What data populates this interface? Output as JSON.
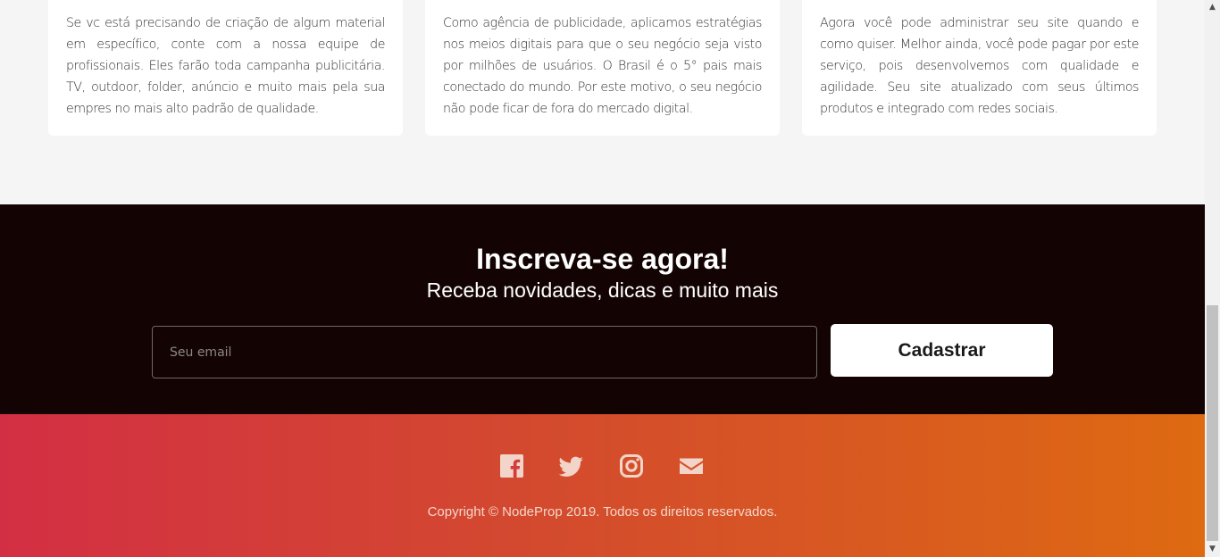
{
  "services": {
    "cards": [
      {
        "text": "Se vc está precisando de criação de algum material em específico, conte com a nossa equipe de profissionais. Eles farão toda campanha publicitária. TV, outdoor, folder, anúncio e muito mais pela sua empres no mais alto padrão de qualidade."
      },
      {
        "text": "Como agência de publicidade, aplicamos estratégias nos meios digitais para que o seu negócio seja visto por milhões de usuários. O Brasil é o 5° pais mais conectado do mundo. Por este motivo, o seu negócio não pode ficar de fora do mercado digital."
      },
      {
        "text": "Agora você pode administrar seu site quando e como quiser. Melhor ainda, você pode pagar por este serviço, pois desenvolvemos com qualidade e agilidade. Seu site atualizado com seus últimos produtos e integrado com redes sociais."
      }
    ]
  },
  "subscribe": {
    "title": "Inscreva-se agora!",
    "subtitle": "Receba novidades, dicas e muito mais",
    "email_placeholder": "Seu email",
    "button_label": "Cadastrar"
  },
  "footer": {
    "social": [
      {
        "icon": "facebook-icon"
      },
      {
        "icon": "twitter-icon"
      },
      {
        "icon": "instagram-icon"
      },
      {
        "icon": "envelope-icon"
      }
    ],
    "copyright": "Copyright © NodeProp 2019. Todos os direitos reservados.",
    "icon_color": "#f3d4c8"
  },
  "colors": {
    "subscribe_bg": "#130403",
    "footer_gradient_start": "#d32f44",
    "footer_gradient_end": "#de6a12",
    "services_bg": "#f5f5f5"
  }
}
